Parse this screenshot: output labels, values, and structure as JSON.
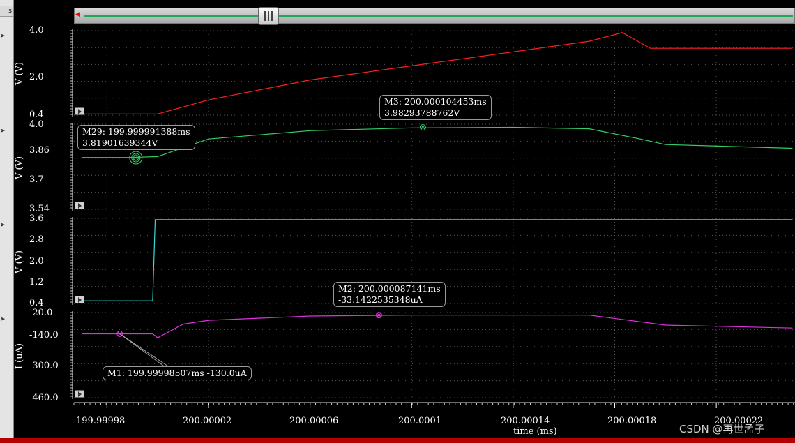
{
  "chart_data": [
    {
      "type": "line",
      "ylabel": "V (V)",
      "ytick_labels": [
        "4.0",
        "2.0",
        "0.4"
      ],
      "ylim": [
        0.4,
        4.0
      ],
      "color": "#ff2020",
      "x": [
        199.99997,
        200.0,
        200.00002,
        200.00006,
        200.0001,
        200.00014,
        200.00017,
        200.000183,
        200.000194,
        200.00025
      ],
      "series": [
        {
          "values": [
            0.45,
            0.45,
            1.05,
            1.9,
            2.5,
            3.1,
            3.55,
            3.92,
            3.25,
            3.25
          ]
        }
      ],
      "markers": []
    },
    {
      "type": "line",
      "ylabel": "V (V)",
      "ytick_labels": [
        "4.0",
        "3.86",
        "3.7",
        "3.54"
      ],
      "ylim": [
        3.54,
        4.0
      ],
      "color": "#33cc66",
      "x": [
        199.99997,
        199.99999,
        200.0,
        200.00002,
        200.00006,
        200.0001,
        200.00014,
        200.00017,
        200.00019,
        200.0002,
        200.00025
      ],
      "series": [
        {
          "values": [
            3.82,
            3.82,
            3.825,
            3.92,
            3.965,
            3.98,
            3.983,
            3.975,
            3.92,
            3.89,
            3.87
          ]
        }
      ],
      "markers": [
        {
          "label": "M29: 199.999991388ms",
          "value": "3.81901639344V",
          "x": 199.999991388,
          "y": 3.819
        },
        {
          "label": "M3: 200.000104453ms",
          "value": "3.98293788762V",
          "x": 200.000104453,
          "y": 3.9829
        }
      ]
    },
    {
      "type": "line",
      "ylabel": "V (V)",
      "ytick_labels": [
        "3.6",
        "2.8",
        "2.0",
        "1.2",
        "0.4"
      ],
      "ylim": [
        0.4,
        3.6
      ],
      "color": "#33dddd",
      "x": [
        199.99997,
        199.999998,
        199.999999,
        200.00025
      ],
      "series": [
        {
          "values": [
            0.5,
            0.5,
            3.55,
            3.55
          ]
        }
      ],
      "markers": []
    },
    {
      "type": "line",
      "ylabel": "I (uA)",
      "ytick_labels": [
        "-20.0",
        "-140.0",
        "-300.0",
        "-460.0"
      ],
      "ylim": [
        -460.0,
        -20.0
      ],
      "color": "#dd33dd",
      "x": [
        199.99997,
        199.999998,
        200.0,
        200.00001,
        200.00002,
        200.00006,
        200.0001,
        200.00017,
        200.0002,
        200.00025
      ],
      "series": [
        {
          "values": [
            -130.0,
            -130.0,
            -150,
            -80,
            -60,
            -38,
            -33.1,
            -33.5,
            -85,
            -100
          ]
        }
      ],
      "markers": [
        {
          "label": "M1: 199.99998507ms -130.0uA",
          "value": "",
          "x": 199.99998507,
          "y": -130.0
        },
        {
          "label": "M2: 200.000087141ms",
          "value": "-33.1422535348uA",
          "x": 200.000087141,
          "y": -33.14
        }
      ]
    }
  ],
  "x_axis": {
    "label": "time (ms)",
    "tick_labels": [
      "199.99998",
      "200.00002",
      "200.00006",
      "200.0001",
      "200.00014",
      "200.00018",
      "200.00022"
    ],
    "tick_values": [
      199.99998,
      200.00002,
      200.00006,
      200.0001,
      200.00014,
      200.00018,
      200.00022
    ],
    "xlim": [
      199.999967,
      200.000251
    ],
    "grid": true
  },
  "watermark": "CSDN @再世孟子",
  "left_tab": "s"
}
